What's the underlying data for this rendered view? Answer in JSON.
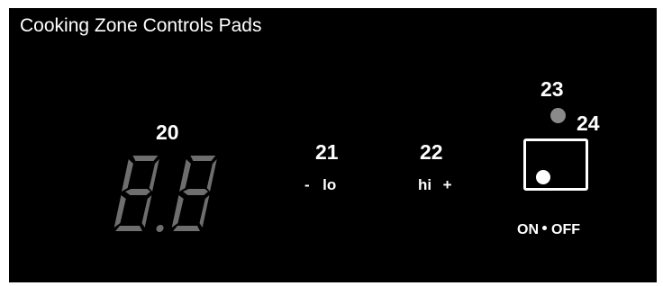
{
  "title": "Cooking Zone Controls Pads",
  "colors": {
    "background": "#000000",
    "foreground": "#ffffff",
    "segment_dim": "#6e6e6e",
    "indicator_light": "#8a8a8a"
  },
  "display": {
    "callout": "20",
    "digits": "8.8",
    "icon": "seven-segment-display-icon"
  },
  "lo_pad": {
    "callout": "21",
    "minus": "-",
    "label": "lo"
  },
  "hi_pad": {
    "callout": "22",
    "label": "hi",
    "plus": "+"
  },
  "indicator": {
    "callout": "23",
    "icon": "indicator-light-icon"
  },
  "onoff_pad": {
    "callout": "24",
    "on_label": "ON",
    "off_label": "OFF"
  }
}
